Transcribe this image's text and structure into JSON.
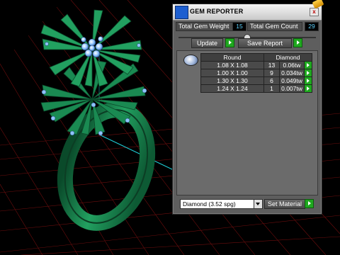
{
  "window": {
    "title": "GEM REPORTER",
    "close_label": "x"
  },
  "stats": {
    "weight_label": "Total Gem Weight",
    "weight_value": "15",
    "count_label": "Total Gem Count",
    "count_value": "29"
  },
  "buttons": {
    "update_label": "Update",
    "save_report_label": "Save Report",
    "set_material_label": "Set Material"
  },
  "table": {
    "headers": [
      "Round",
      "Diamond"
    ],
    "rows": [
      {
        "size": "1.08 X 1.08",
        "count": "13",
        "weight": "0.06tw"
      },
      {
        "size": "1.00 X 1.00",
        "count": "9",
        "weight": "0.034tw"
      },
      {
        "size": "1.30 X 1.30",
        "count": "6",
        "weight": "0.049tw"
      },
      {
        "size": "1.24 X 1.24",
        "count": "1",
        "weight": "0.007tw"
      }
    ]
  },
  "material": {
    "selected": "Diamond   (3.52 spg)"
  },
  "icons": {
    "app": "gem-reporter-icon",
    "gem": "round-gem-icon",
    "row_arrow": "green-arrow-icon"
  },
  "colors": {
    "ring_green": "#1a8a52",
    "grid_red": "#7a1010",
    "value_cyan": "#5fd3ff",
    "arrow_green": "#1fa81f"
  }
}
